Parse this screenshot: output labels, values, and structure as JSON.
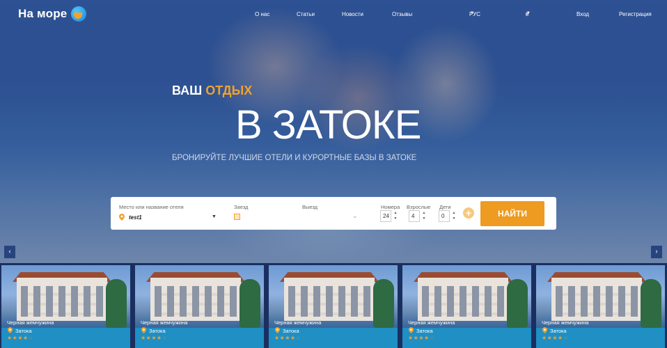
{
  "brand": {
    "name": "На море"
  },
  "nav": {
    "about": "О нас",
    "articles": "Статьи",
    "news": "Новости",
    "reviews": "Отзывы",
    "language": "РУС",
    "currency": "₴",
    "login": "Вход",
    "register": "Регистрация"
  },
  "hero": {
    "kicker_plain": "ВАШ",
    "kicker_accent": "ОТДЫХ",
    "headline": "В ЗАТОКЕ",
    "subline": "БРОНИРУЙТЕ ЛУЧШИЕ ОТЕЛИ И КУРОРТНЫЕ БАЗЫ В ЗАТОКЕ"
  },
  "search": {
    "location_label": "Место или название отеля",
    "location_value": "test1",
    "checkin_label": "Заезд",
    "checkout_label": "Выезд",
    "rooms_label": "Номера",
    "rooms_value": "24",
    "adults_label": "Взрослые",
    "adults_value": "4",
    "children_label": "Дети",
    "children_value": "0",
    "submit_label": "НАЙТИ"
  },
  "carousel": {
    "prev_icon": "chevron-left-icon",
    "next_icon": "chevron-right-icon",
    "cards": [
      {
        "name": "Черная жемчужина",
        "town": "Затока",
        "rating": 4
      },
      {
        "name": "Черная жемчужина",
        "town": "Затока",
        "rating": 4
      },
      {
        "name": "Черная жемчужина",
        "town": "Затока",
        "rating": 4
      },
      {
        "name": "Черная жемчужина",
        "town": "Затока",
        "rating": 4
      },
      {
        "name": "Черная жемчужина",
        "town": "Затока",
        "rating": 4
      }
    ]
  },
  "colors": {
    "accent": "#ee9b21",
    "overlay": "#2a4d94"
  }
}
